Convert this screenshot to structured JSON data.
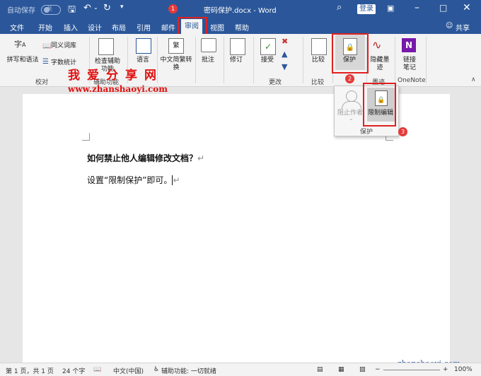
{
  "titlebar": {
    "autosave_label": "自动保存",
    "autosave_state": "关",
    "title": "密码保护.docx  -  Word",
    "login_label": "登录"
  },
  "tabs": [
    "文件",
    "开始",
    "插入",
    "设计",
    "布局",
    "引用",
    "邮件",
    "审阅",
    "视图",
    "帮助"
  ],
  "active_tab": "审阅",
  "share_label": "共享",
  "ribbon": {
    "spelling": "拼写和语法",
    "thesaurus": "同义词库",
    "wordcount": "字数统计",
    "group_proofing": "校对",
    "check_access": "检查辅助功能",
    "group_access": "辅助功能",
    "language": "语言",
    "chinese_conv": "中文简繁转换",
    "comment": "批注",
    "track": "修订",
    "accept": "接受",
    "group_changes": "更改",
    "compare": "比较",
    "group_compare": "比较",
    "protect": "保护",
    "ink": "隐藏墨迹",
    "group_ink": "墨迹",
    "onenote": "链接笔记",
    "group_onenote": "OneNote"
  },
  "dropdown": {
    "block_authors": "阻止作者",
    "restrict_editing": "限制编辑",
    "group_label": "保护"
  },
  "badges": [
    "1",
    "2",
    "3"
  ],
  "watermark": {
    "chars": [
      "我",
      "爱",
      "分",
      "享",
      "网"
    ],
    "url": "www.zhanshaoyi.com",
    "corner_url": "zhanshaoyi.com"
  },
  "document": {
    "line1": "如何禁止他人编辑修改文档？",
    "line2": "设置“限制保护”即可。",
    "paragraph_mark": "↵"
  },
  "statusbar": {
    "page": "第 1 页，共 1 页",
    "words": "24 个字",
    "language": "中文(中国)",
    "accessibility": "辅助功能: 一切就绪",
    "zoom": "100%"
  },
  "colors": {
    "word_blue": "#2b579a",
    "highlight_red": "#e02020",
    "badge_red": "#e53a3a"
  }
}
